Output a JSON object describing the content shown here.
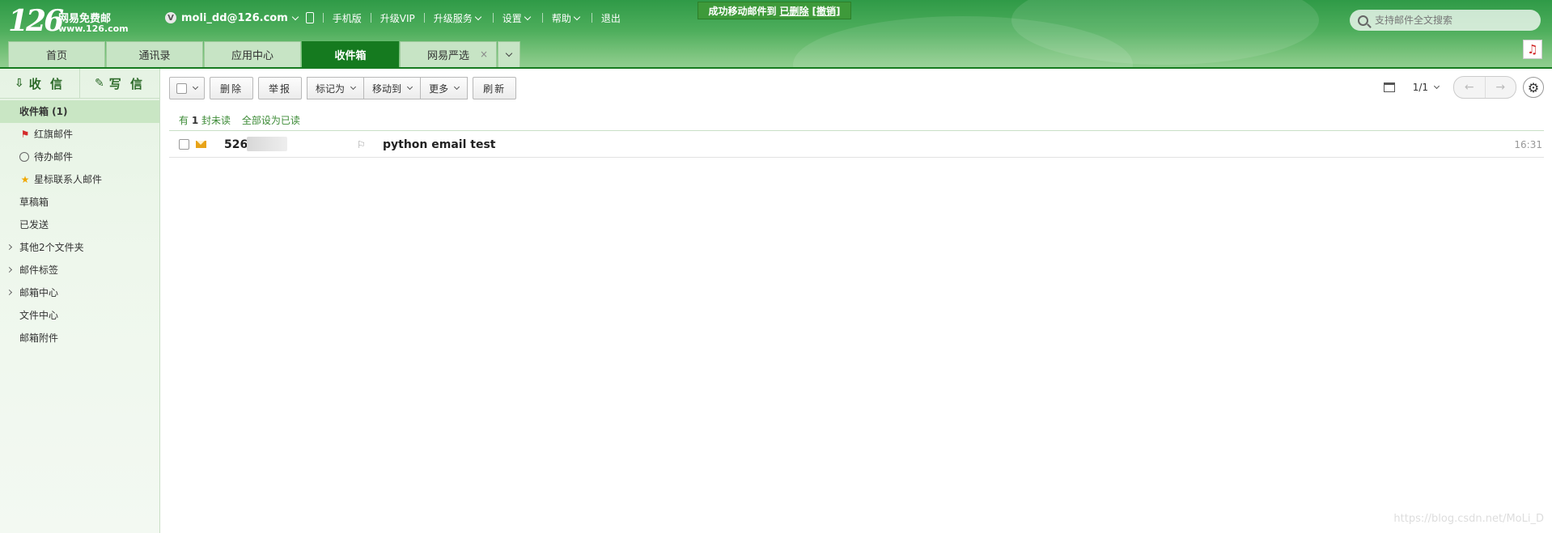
{
  "logo": {
    "number": "126",
    "name": "网易免费邮",
    "url": "www.126.com"
  },
  "topnav": {
    "vip_badge": "V",
    "account": "moli_dd@126.com",
    "items": [
      "手机版",
      "升级VIP",
      "升级服务",
      "设置",
      "帮助",
      "退出"
    ]
  },
  "notification": {
    "text": "成功移动邮件到",
    "link1": "已删除",
    "link2": "[撤销]"
  },
  "search": {
    "placeholder": "支持邮件全文搜索"
  },
  "tabs": [
    {
      "label": "首页",
      "active": false
    },
    {
      "label": "通讯录",
      "active": false
    },
    {
      "label": "应用中心",
      "active": false
    },
    {
      "label": "收件箱",
      "active": true
    },
    {
      "label": "网易严选",
      "active": false,
      "closable": true
    }
  ],
  "tab_close_glyph": "×",
  "sidebar": {
    "receive_label": "收 信",
    "compose_label": "写 信",
    "folders": [
      {
        "label": "收件箱 (1)",
        "active": true
      },
      {
        "label": "红旗邮件",
        "icon": "flag-icon"
      },
      {
        "label": "待办邮件",
        "icon": "clock-icon"
      },
      {
        "label": "星标联系人邮件",
        "icon": "star-icon"
      },
      {
        "label": "草稿箱"
      },
      {
        "label": "已发送"
      },
      {
        "label": "其他2个文件夹",
        "expandable": true
      },
      {
        "label": "邮件标签",
        "expandable": true
      },
      {
        "label": "邮箱中心",
        "expandable": true
      },
      {
        "label": "文件中心"
      },
      {
        "label": "邮箱附件"
      }
    ]
  },
  "toolbar": {
    "delete": "删除",
    "report": "举报",
    "mark_as": "标记为",
    "move_to": "移动到",
    "more": "更多",
    "refresh": "刷新"
  },
  "pager": {
    "page": "1/1"
  },
  "unread": {
    "prefix": "有",
    "count": "1",
    "suffix": "封未读",
    "mark_all": "全部设为已读"
  },
  "messages": [
    {
      "sender": "526",
      "subject": "python email test",
      "time": "16:31",
      "unread": true
    }
  ],
  "watermark": "https://blog.csdn.net/MoLi_D",
  "colors": {
    "brand_green": "#157a1f",
    "header_green": "#4eae5c",
    "unread_envelope": "#e8a317"
  }
}
